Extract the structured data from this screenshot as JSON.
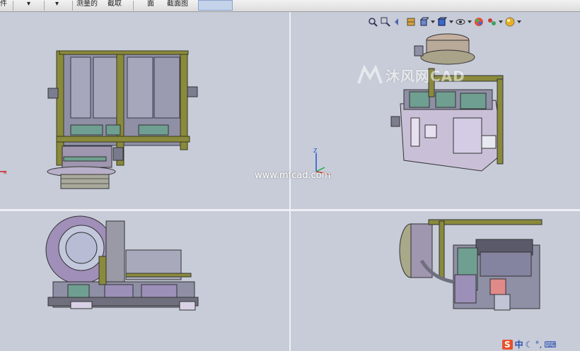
{
  "toolbar": {
    "items": [
      "件",
      "▾",
      "▾",
      "测量的",
      "截取",
      "面",
      "截面图"
    ]
  },
  "watermark": {
    "logo_text": "沐风网",
    "brand_text": "CAD",
    "url": "www.mfcad.com"
  },
  "ime": {
    "logo": "S",
    "lang": "中"
  },
  "colors": {
    "viewport_bg": "#c7ccd8",
    "frame_olive": "#8a8a3c",
    "machine_gray": "#8f8fa6",
    "machine_purple": "#9c8fb8",
    "teal": "#6f9f90"
  }
}
